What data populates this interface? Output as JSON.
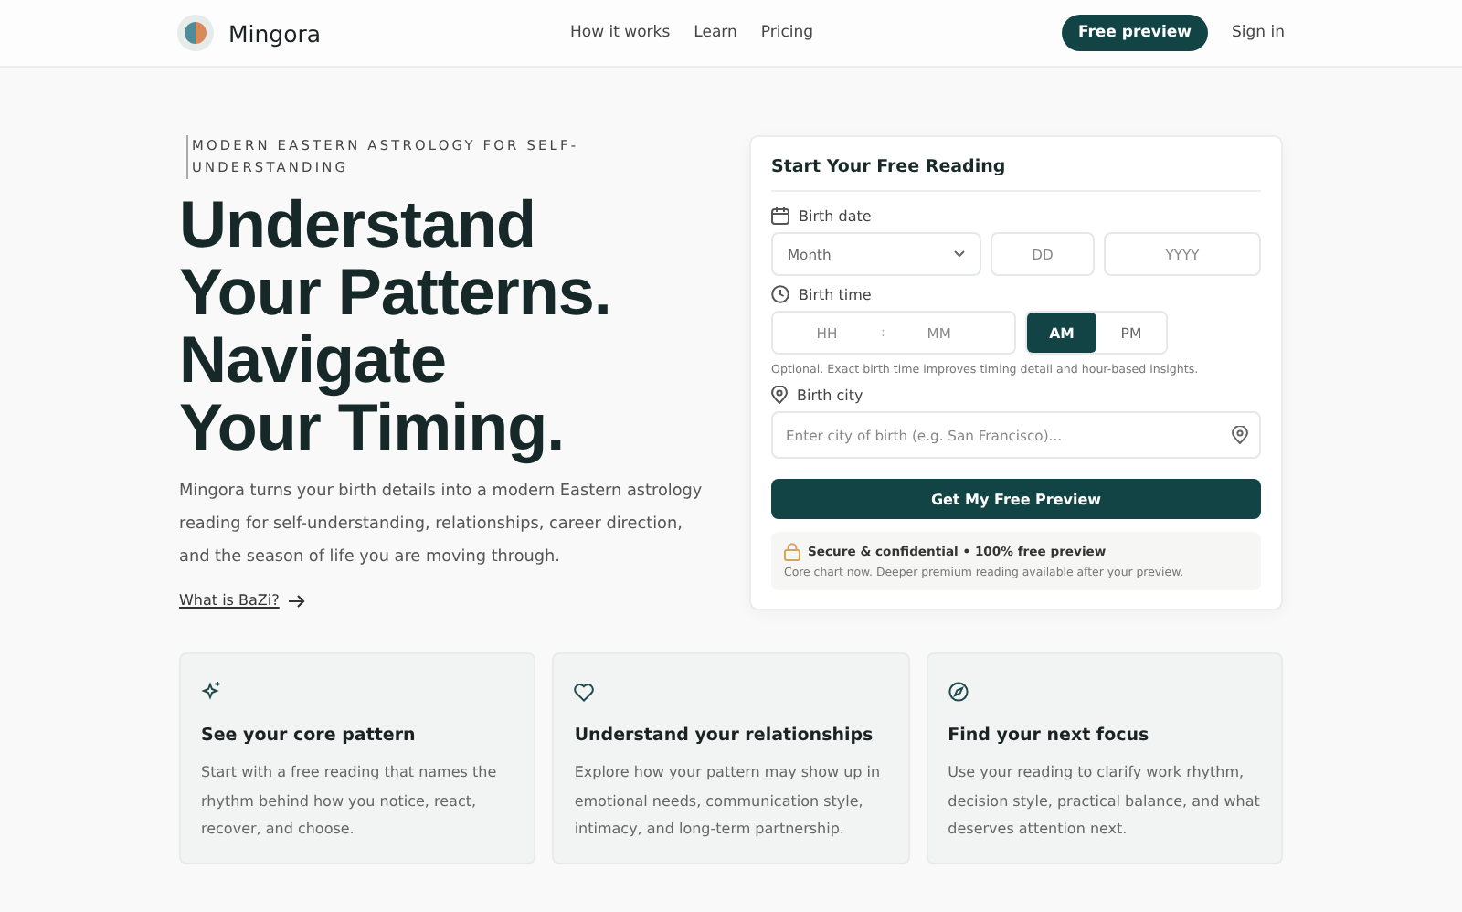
{
  "header": {
    "brand": "Mingora",
    "nav": [
      "How it works",
      "Learn",
      "Pricing"
    ],
    "cta": "Free preview",
    "sign_in": "Sign in"
  },
  "hero": {
    "eyebrow": "MODERN EASTERN ASTROLOGY FOR SELF-UNDERSTANDING",
    "headline": [
      "Understand",
      "Your Patterns.",
      "Navigate",
      "Your Timing."
    ],
    "body": "Mingora turns your birth details into a modern Eastern astrology reading for self-understanding, relationships, career direction, and the season of life you are moving through.",
    "link": "What is BaZi?"
  },
  "form": {
    "title": "Start Your Free Reading",
    "birth_date": {
      "label": "Birth date",
      "month": "Month",
      "day": {
        "placeholder": "DD"
      },
      "year": {
        "placeholder": "YYYY"
      }
    },
    "birth_time": {
      "label": "Birth time",
      "hour": {
        "placeholder": "HH"
      },
      "separator": ":",
      "minute": {
        "placeholder": "MM"
      },
      "periods": [
        {
          "label": "AM",
          "selected": true
        },
        {
          "label": "PM",
          "selected": false
        }
      ],
      "hint": "Optional. Exact birth time improves timing detail and hour-based insights."
    },
    "birth_city": {
      "label": "Birth city",
      "placeholder": "Enter city of birth (e.g. San Francisco)..."
    },
    "submit": "Get My Free Preview",
    "notice": {
      "title": "Secure & confidential • 100% free preview",
      "text": "Core chart now. Deeper premium reading available after your preview."
    }
  },
  "features": [
    {
      "kind": "sparkle",
      "title": "See your core pattern",
      "text": "Start with a free reading that names the rhythm behind how you notice, react, recover, and choose."
    },
    {
      "kind": "heart",
      "title": "Understand your relationships",
      "text": "Explore how your pattern may show up in emotional needs, communication style, intimacy, and long-term partnership."
    },
    {
      "kind": "compass",
      "title": "Find your next focus",
      "text": "Use your reading to clarify work rhythm, decision style, practical balance, and what deserves attention next."
    }
  ]
}
